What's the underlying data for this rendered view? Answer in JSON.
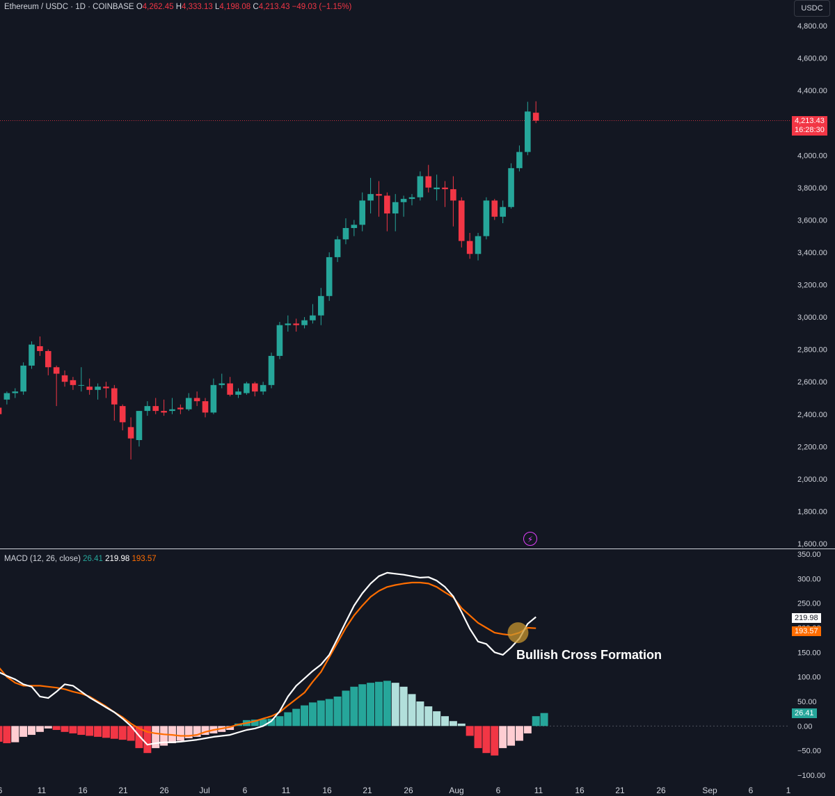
{
  "header": {
    "symbol": "Ethereum / USDC · 1D · COINBASE",
    "o_label": "O",
    "o_value": "4,262.45",
    "h_label": "H",
    "h_value": "4,333.13",
    "l_label": "L",
    "l_value": "4,198.08",
    "c_label": "C",
    "c_value": "4,213.43",
    "change": "−49.03 (−1.15%)"
  },
  "currency_button": "USDC",
  "price_axis": [
    "4,800.00",
    "4,600.00",
    "4,400.00",
    "4,200.00",
    "4,000.00",
    "3,800.00",
    "3,600.00",
    "3,400.00",
    "3,200.00",
    "3,000.00",
    "2,800.00",
    "2,600.00",
    "2,400.00",
    "2,200.00",
    "2,000.00",
    "1,800.00",
    "1,600.00"
  ],
  "last_price_tag": {
    "price": "4,213.43",
    "countdown": "16:28:30"
  },
  "macd_header": {
    "label": "MACD (12, 26, close)",
    "hist": "26.41",
    "macd": "219.98",
    "signal": "193.57"
  },
  "macd_axis": [
    "350.00",
    "300.00",
    "250.00",
    "200.00",
    "150.00",
    "100.00",
    "50.00",
    "0.00",
    "−50.00",
    "−100.00"
  ],
  "macd_tags": {
    "macd": "219.98",
    "signal": "193.57",
    "hist": "26.41"
  },
  "date_axis": [
    "6",
    "11",
    "16",
    "21",
    "26",
    "Jul",
    "6",
    "11",
    "16",
    "21",
    "26",
    "Aug",
    "6",
    "11",
    "16",
    "21",
    "26",
    "Sep",
    "6",
    "1"
  ],
  "annotation": "Bullish Cross Formation",
  "icons": {
    "flash": "flash-icon"
  },
  "colors": {
    "up": "#26a69a",
    "down": "#f23645",
    "hist_up_light": "#b2dfdb",
    "hist_down_light": "#ffcdd2",
    "macd_line": "#ffffff",
    "signal_line": "#ff6d00",
    "background": "#131722"
  },
  "chart_data": [
    {
      "type": "candlestick",
      "title": "Ethereum / USDC · 1D · COINBASE",
      "ylim": [
        1600,
        4800
      ],
      "start_date": "2025-06-06",
      "ohlc": [
        [
          2440,
          2480,
          2380,
          2400
        ],
        [
          2490,
          2540,
          2460,
          2530
        ],
        [
          2530,
          2560,
          2500,
          2540
        ],
        [
          2540,
          2720,
          2520,
          2700
        ],
        [
          2700,
          2850,
          2680,
          2830
        ],
        [
          2820,
          2880,
          2760,
          2790
        ],
        [
          2790,
          2800,
          2640,
          2690
        ],
        [
          2690,
          2700,
          2450,
          2650
        ],
        [
          2640,
          2670,
          2570,
          2600
        ],
        [
          2610,
          2630,
          2550,
          2580
        ],
        [
          2580,
          2690,
          2540,
          2580
        ],
        [
          2570,
          2620,
          2520,
          2550
        ],
        [
          2550,
          2590,
          2490,
          2570
        ],
        [
          2570,
          2600,
          2500,
          2560
        ],
        [
          2560,
          2580,
          2360,
          2460
        ],
        [
          2450,
          2460,
          2300,
          2350
        ],
        [
          2320,
          2380,
          2120,
          2250
        ],
        [
          2240,
          2420,
          2200,
          2420
        ],
        [
          2420,
          2480,
          2390,
          2450
        ],
        [
          2450,
          2500,
          2400,
          2420
        ],
        [
          2420,
          2490,
          2390,
          2410
        ],
        [
          2420,
          2500,
          2400,
          2430
        ],
        [
          2440,
          2460,
          2400,
          2430
        ],
        [
          2430,
          2530,
          2420,
          2500
        ],
        [
          2500,
          2540,
          2450,
          2480
        ],
        [
          2480,
          2500,
          2380,
          2410
        ],
        [
          2410,
          2620,
          2400,
          2580
        ],
        [
          2580,
          2650,
          2560,
          2590
        ],
        [
          2590,
          2630,
          2510,
          2520
        ],
        [
          2520,
          2560,
          2500,
          2540
        ],
        [
          2530,
          2600,
          2520,
          2590
        ],
        [
          2590,
          2600,
          2510,
          2540
        ],
        [
          2540,
          2600,
          2520,
          2580
        ],
        [
          2580,
          2780,
          2560,
          2760
        ],
        [
          2760,
          2970,
          2740,
          2950
        ],
        [
          2950,
          3010,
          2910,
          2960
        ],
        [
          2960,
          2990,
          2910,
          2950
        ],
        [
          2950,
          3000,
          2930,
          2980
        ],
        [
          2980,
          3080,
          2960,
          3010
        ],
        [
          3010,
          3180,
          2950,
          3130
        ],
        [
          3130,
          3400,
          3100,
          3370
        ],
        [
          3370,
          3500,
          3340,
          3480
        ],
        [
          3480,
          3610,
          3450,
          3550
        ],
        [
          3550,
          3600,
          3500,
          3570
        ],
        [
          3570,
          3770,
          3530,
          3720
        ],
        [
          3720,
          3860,
          3640,
          3760
        ],
        [
          3760,
          3840,
          3620,
          3750
        ],
        [
          3750,
          3770,
          3530,
          3640
        ],
        [
          3640,
          3760,
          3530,
          3710
        ],
        [
          3710,
          3750,
          3620,
          3730
        ],
        [
          3730,
          3760,
          3690,
          3740
        ],
        [
          3740,
          3900,
          3720,
          3870
        ],
        [
          3870,
          3940,
          3770,
          3800
        ],
        [
          3790,
          3880,
          3720,
          3800
        ],
        [
          3800,
          3840,
          3680,
          3790
        ],
        [
          3790,
          3870,
          3560,
          3720
        ],
        [
          3720,
          3740,
          3430,
          3470
        ],
        [
          3470,
          3520,
          3360,
          3390
        ],
        [
          3390,
          3520,
          3350,
          3500
        ],
        [
          3500,
          3740,
          3480,
          3720
        ],
        [
          3720,
          3730,
          3600,
          3620
        ],
        [
          3620,
          3720,
          3580,
          3680
        ],
        [
          3680,
          3950,
          3670,
          3920
        ],
        [
          3920,
          4060,
          3900,
          4020
        ],
        [
          4020,
          4330,
          4000,
          4270
        ],
        [
          4262.45,
          4333.13,
          4198.08,
          4213.43
        ]
      ]
    },
    {
      "type": "line",
      "title": "MACD (12, 26, close)",
      "ylim": [
        -100,
        350
      ],
      "series": [
        {
          "name": "MACD",
          "values": [
            110,
            102,
            95,
            85,
            80,
            60,
            57,
            70,
            85,
            82,
            70,
            58,
            48,
            38,
            28,
            15,
            0,
            -20,
            -38,
            -35,
            -33,
            -33,
            -32,
            -30,
            -28,
            -25,
            -22,
            -20,
            -18,
            -13,
            -8,
            -5,
            0,
            10,
            30,
            60,
            82,
            97,
            112,
            125,
            145,
            178,
            212,
            245,
            270,
            290,
            305,
            312,
            310,
            308,
            305,
            302,
            303,
            296,
            283,
            264,
            232,
            198,
            172,
            167,
            150,
            145,
            160,
            178,
            208,
            222
          ]
        },
        {
          "name": "Signal",
          "values": [
            120,
            100,
            88,
            82,
            82,
            82,
            80,
            78,
            75,
            70,
            66,
            60,
            50,
            40,
            28,
            18,
            5,
            -5,
            -12,
            -15,
            -17,
            -18,
            -20,
            -20,
            -18,
            -12,
            -8,
            -5,
            -2,
            3,
            6,
            10,
            15,
            20,
            28,
            42,
            55,
            68,
            90,
            110,
            140,
            170,
            200,
            225,
            245,
            263,
            275,
            283,
            287,
            290,
            292,
            292,
            290,
            283,
            272,
            262,
            240,
            225,
            210,
            200,
            190,
            187,
            185,
            190,
            200,
            199
          ]
        },
        {
          "name": "Histogram",
          "values": [
            -32,
            -35,
            -33,
            -22,
            -18,
            -12,
            -5,
            -8,
            -12,
            -15,
            -18,
            -20,
            -22,
            -24,
            -26,
            -28,
            -30,
            -45,
            -55,
            -45,
            -40,
            -35,
            -30,
            -25,
            -22,
            -18,
            -15,
            -12,
            -8,
            5,
            12,
            13,
            14,
            15,
            20,
            28,
            35,
            42,
            48,
            52,
            55,
            60,
            72,
            80,
            85,
            88,
            90,
            92,
            88,
            80,
            65,
            50,
            40,
            30,
            20,
            10,
            5,
            -20,
            -45,
            -55,
            -60,
            -45,
            -40,
            -30,
            -15,
            20,
            26.41
          ]
        }
      ]
    }
  ]
}
